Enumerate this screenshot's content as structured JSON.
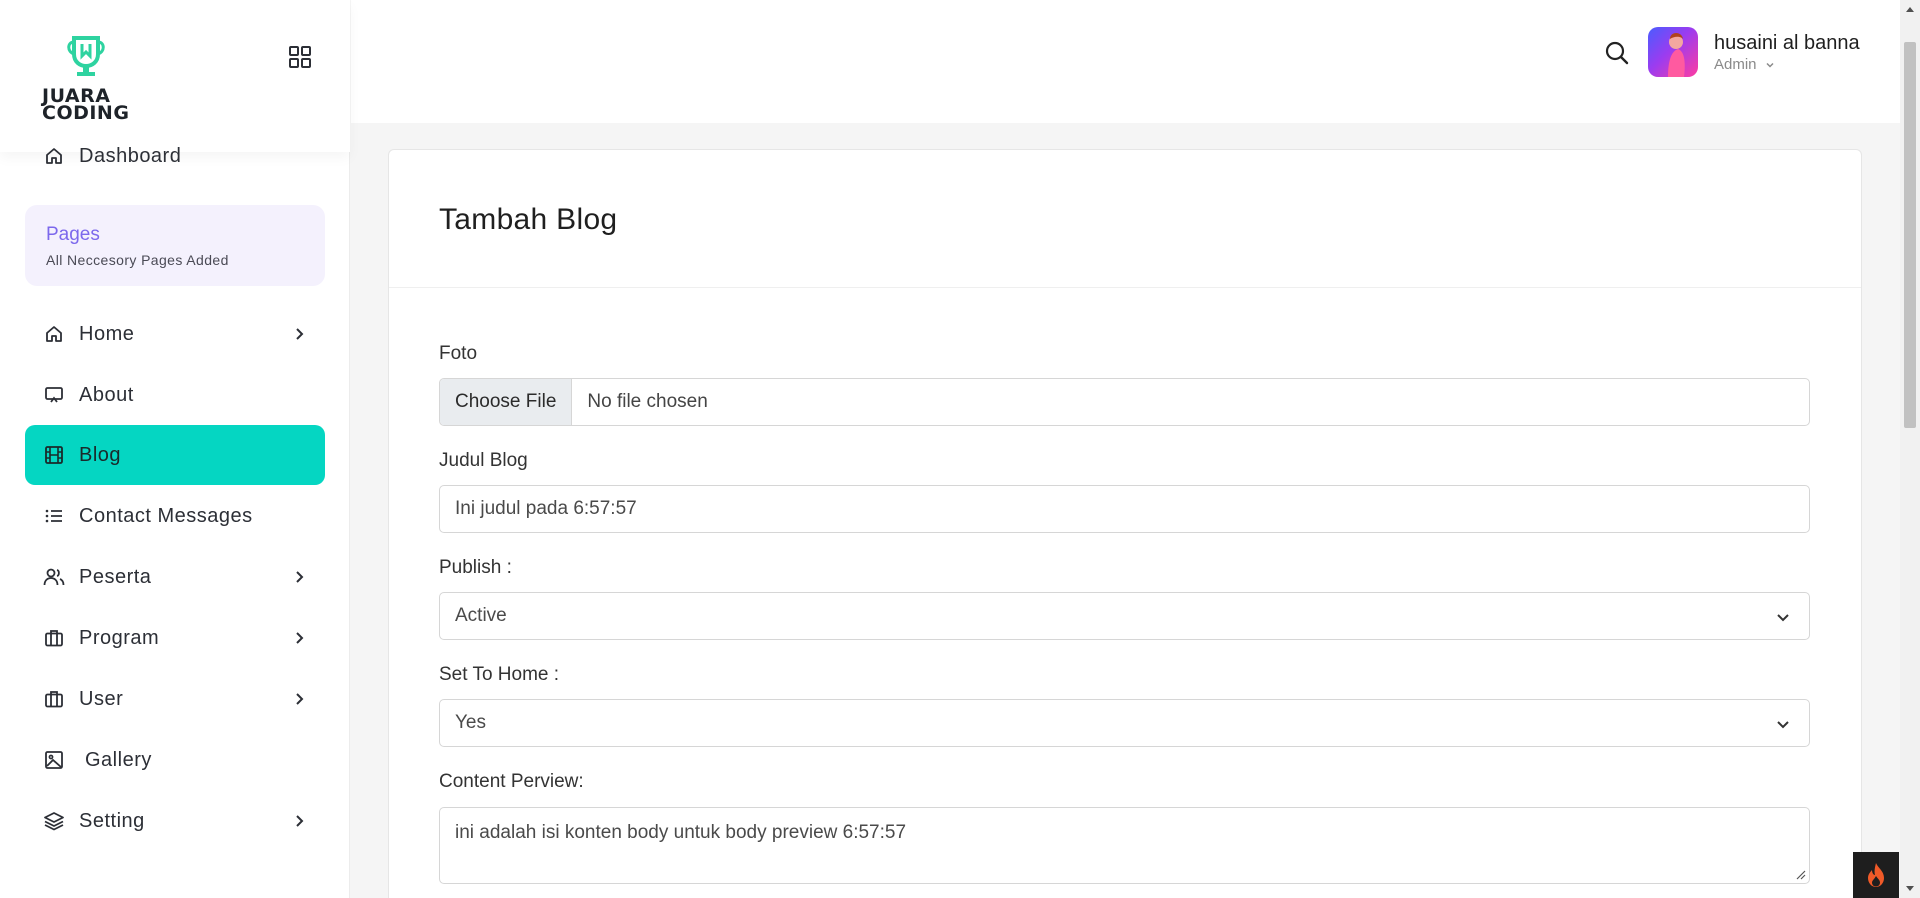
{
  "brand": {
    "logo_line1": "JUARA",
    "logo_line2": "CODING",
    "accent_color": "#2ed3a0"
  },
  "sidebar": {
    "dashboard_label": "Dashboard",
    "pages_card": {
      "title": "Pages",
      "subtitle": "All Neccesory Pages Added"
    },
    "items": [
      {
        "label": "Home",
        "icon": "home-icon",
        "has_submenu": true
      },
      {
        "label": "About",
        "icon": "presentation-icon",
        "has_submenu": false
      },
      {
        "label": "Blog",
        "icon": "film-icon",
        "has_submenu": false,
        "active": true
      },
      {
        "label": "Contact Messages",
        "icon": "list-icon",
        "has_submenu": false
      },
      {
        "label": "Peserta",
        "icon": "users-icon",
        "has_submenu": true
      },
      {
        "label": "Program",
        "icon": "briefcase-icon",
        "has_submenu": true
      },
      {
        "label": "User",
        "icon": "briefcase-icon",
        "has_submenu": true
      },
      {
        "label": "Gallery",
        "icon": "image-icon",
        "has_submenu": false
      },
      {
        "label": "Setting",
        "icon": "layers-icon",
        "has_submenu": true
      }
    ],
    "active_color": "#05d6c2"
  },
  "header": {
    "user_name": "husaini al banna",
    "user_role": "Admin"
  },
  "form": {
    "title": "Tambah Blog",
    "foto_label": "Foto",
    "file_button": "Choose File",
    "file_status": "No file chosen",
    "judul_label": "Judul Blog",
    "judul_value": "Ini judul pada 6:57:57",
    "publish_label": "Publish :",
    "publish_value": "Active",
    "home_label": "Set To Home :",
    "home_value": "Yes",
    "content_label": "Content Perview:",
    "content_value": "ini adalah isi konten body untuk body preview 6:57:57"
  }
}
